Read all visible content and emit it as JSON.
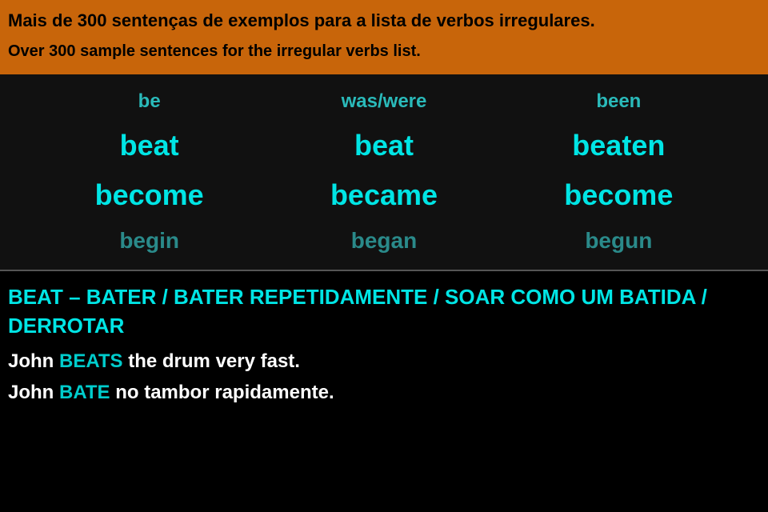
{
  "header": {
    "pt_text": "Mais de 300 sentenças de exemplos para a lista de verbos irregulares.",
    "en_text": "Over 300 sample sentences for the irregular verbs list."
  },
  "verb_table": {
    "rows": [
      {
        "col1": "be",
        "col2": "was/were",
        "col3": "been",
        "style": "small"
      },
      {
        "col1": "beat",
        "col2": "beat",
        "col3": "beaten",
        "style": "large"
      },
      {
        "col1": "become",
        "col2": "became",
        "col3": "become",
        "style": "large"
      },
      {
        "col1": "begin",
        "col2": "began",
        "col3": "begun",
        "style": "dim"
      }
    ]
  },
  "content": {
    "title": "BEAT – BATER / BATER REPETIDAMENTE / SOAR COMO UM BATIDA / DERROTAR",
    "sentences": [
      {
        "prefix": "John ",
        "highlight": "BEATS",
        "suffix": " the drum very fast."
      },
      {
        "prefix": "John ",
        "highlight": "BATE",
        "suffix": " no tambor rapidamente."
      }
    ]
  }
}
